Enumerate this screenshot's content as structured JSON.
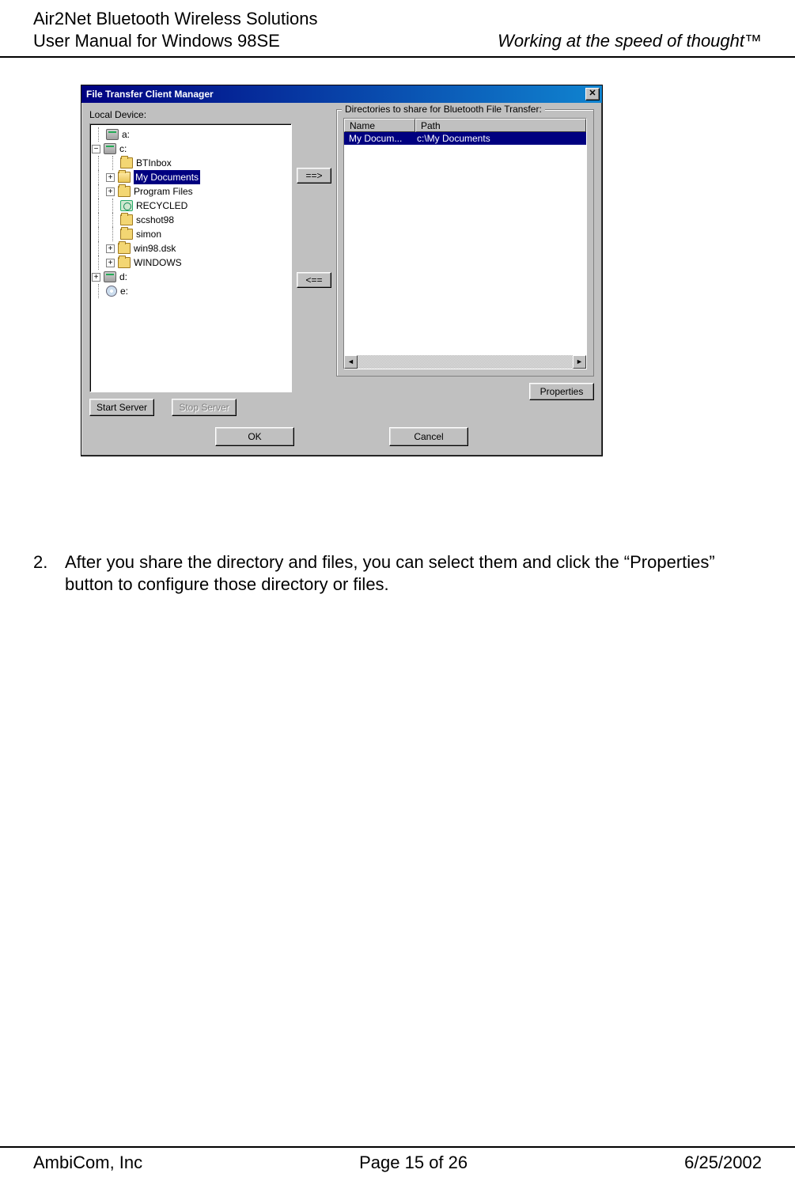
{
  "header": {
    "left_line1": "Air2Net Bluetooth Wireless Solutions",
    "left_line2": "User Manual for Windows 98SE",
    "right": "Working at the speed of thought™"
  },
  "footer": {
    "left": "AmbiCom, Inc",
    "center": "Page 15 of 26",
    "right": "6/25/2002"
  },
  "dialog": {
    "title": "File Transfer Client  Manager",
    "close_glyph": "✕",
    "local_device_label": "Local Device:",
    "share_group_label": "Directories to share for Bluetooth File Transfer:",
    "tree": {
      "a": "a:",
      "c": "c:",
      "c_children": {
        "btinbox": "BTInbox",
        "mydocs": "My Documents",
        "progfiles": "Program Files",
        "recycled": "RECYCLED",
        "scshot98": "scshot98",
        "simon": "simon",
        "win98dsk": "win98.dsk",
        "windows": "WINDOWS"
      },
      "d": "d:",
      "e": "e:"
    },
    "mid_buttons": {
      "add": "==>",
      "remove": "<=="
    },
    "listview": {
      "col_name": "Name",
      "col_path": "Path",
      "row1_name": "My Docum...",
      "row1_path": "c:\\My Documents"
    },
    "scroll": {
      "left": "◄",
      "right": "►"
    },
    "buttons": {
      "start_server": "Start Server",
      "stop_server": "Stop Server",
      "properties": "Properties",
      "ok": "OK",
      "cancel": "Cancel"
    }
  },
  "body": {
    "item_number": "2.",
    "item_text": "After you share the directory and files, you can select them and click the “Properties” button to configure those directory or files."
  }
}
